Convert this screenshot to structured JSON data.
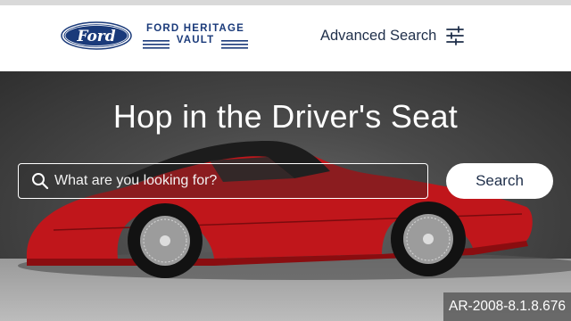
{
  "header": {
    "logo": {
      "oval_text": "Ford",
      "wordmark_line1": "FORD HERITAGE",
      "wordmark_line2": "VAULT"
    },
    "advanced_search": {
      "label": "Advanced Search",
      "icon": "sliders-icon"
    }
  },
  "hero": {
    "title": "Hop in the Driver's Seat",
    "search": {
      "placeholder": "What are you looking for?",
      "value": "",
      "icon": "search-icon",
      "button_label": "Search"
    },
    "asset_id": "AR-2008-8.1.8.676"
  },
  "colors": {
    "brand_blue": "#1a3a7a",
    "text_dark": "#1f2f4a",
    "car_red": "#c0161b"
  }
}
